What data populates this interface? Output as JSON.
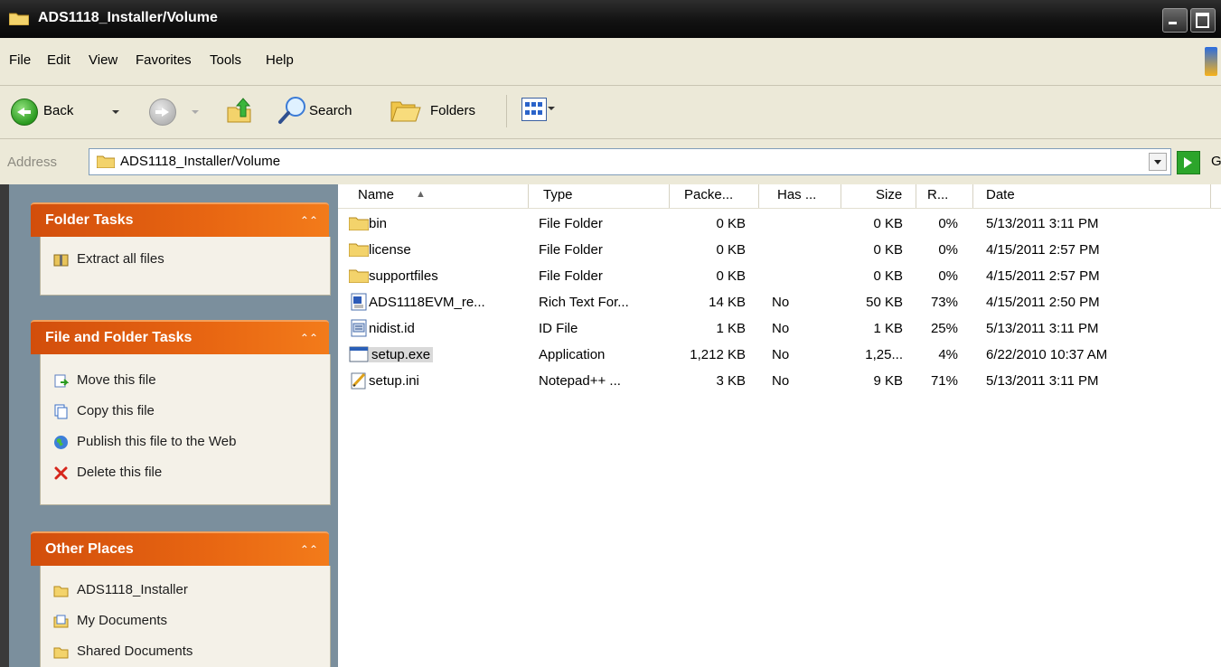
{
  "window": {
    "title": "ADS1118_Installer/Volume"
  },
  "menu": [
    "File",
    "Edit",
    "View",
    "Favorites",
    "Tools",
    "Help"
  ],
  "toolbar": {
    "back": "Back",
    "search": "Search",
    "folders": "Folders"
  },
  "address": {
    "label": "Address",
    "path": "ADS1118_Installer/Volume",
    "go": "G"
  },
  "sidebar": {
    "folder_tasks": {
      "title": "Folder Tasks",
      "items": [
        {
          "label": "Extract all files",
          "icon": "extract-icon"
        }
      ]
    },
    "file_folder_tasks": {
      "title": "File and Folder Tasks",
      "items": [
        {
          "label": "Move this file",
          "icon": "move-icon"
        },
        {
          "label": "Copy this file",
          "icon": "copy-icon"
        },
        {
          "label": "Publish this file to the Web",
          "icon": "globe-icon"
        },
        {
          "label": "Delete this file",
          "icon": "delete-icon"
        }
      ]
    },
    "other_places": {
      "title": "Other Places",
      "items": [
        {
          "label": "ADS1118_Installer",
          "icon": "folder-icon"
        },
        {
          "label": "My Documents",
          "icon": "documents-icon"
        },
        {
          "label": "Shared Documents",
          "icon": "folder-icon"
        }
      ]
    }
  },
  "columns": [
    "Name",
    "Type",
    "Packe...",
    "Has ...",
    "Size",
    "R...",
    "Date"
  ],
  "files": [
    {
      "name": "bin",
      "icon": "folder-icon",
      "type": "File Folder",
      "packed": "0 KB",
      "has": "",
      "size": "0 KB",
      "ratio": "0%",
      "date": "5/13/2011 3:11 PM"
    },
    {
      "name": "license",
      "icon": "folder-icon",
      "type": "File Folder",
      "packed": "0 KB",
      "has": "",
      "size": "0 KB",
      "ratio": "0%",
      "date": "4/15/2011 2:57 PM"
    },
    {
      "name": "supportfiles",
      "icon": "folder-icon",
      "type": "File Folder",
      "packed": "0 KB",
      "has": "",
      "size": "0 KB",
      "ratio": "0%",
      "date": "4/15/2011 2:57 PM"
    },
    {
      "name": "ADS1118EVM_re...",
      "icon": "rtf-icon",
      "type": "Rich Text For...",
      "packed": "14 KB",
      "has": "No",
      "size": "50 KB",
      "ratio": "73%",
      "date": "4/15/2011 2:50 PM"
    },
    {
      "name": "nidist.id",
      "icon": "id-file-icon",
      "type": "ID File",
      "packed": "1 KB",
      "has": "No",
      "size": "1 KB",
      "ratio": "25%",
      "date": "5/13/2011 3:11 PM"
    },
    {
      "name": "setup.exe",
      "icon": "exe-icon",
      "type": "Application",
      "packed": "1,212 KB",
      "has": "No",
      "size": "1,25...",
      "ratio": "4%",
      "date": "6/22/2010 10:37 AM",
      "selected": true
    },
    {
      "name": "setup.ini",
      "icon": "ini-icon",
      "type": "Notepad++ ...",
      "packed": "3 KB",
      "has": "No",
      "size": "9 KB",
      "ratio": "71%",
      "date": "5/13/2011 3:11 PM"
    }
  ]
}
